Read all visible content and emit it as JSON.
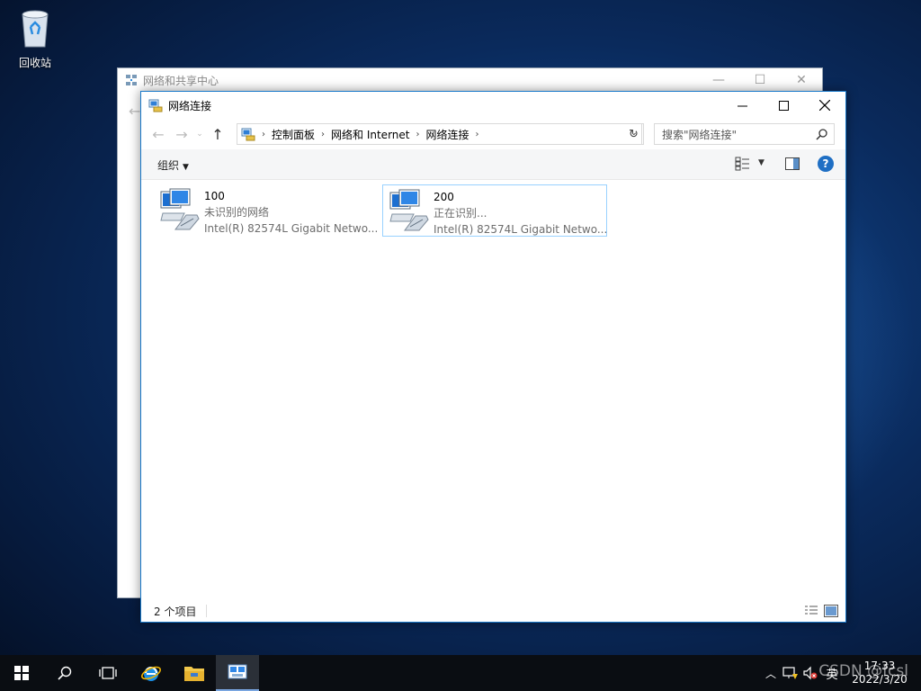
{
  "desktop": {
    "recycle_bin_label": "回收站"
  },
  "back_window": {
    "title": "网络和共享中心"
  },
  "window": {
    "title": "网络连接",
    "breadcrumb": [
      "控制面板",
      "网络和 Internet",
      "网络连接"
    ],
    "search_placeholder": "搜索\"网络连接\"",
    "organize_label": "组织",
    "help_label": "?",
    "items": [
      {
        "name": "100",
        "status": "未识别的网络",
        "device": "Intel(R) 82574L Gigabit Netwo..."
      },
      {
        "name": "200",
        "status": "正在识别...",
        "device": "Intel(R) 82574L Gigabit Netwo..."
      }
    ],
    "status_count": "2 个项目"
  },
  "taskbar": {
    "ime": "英",
    "time": "17:33",
    "date": "2022/3/20",
    "watermark": "CSDN @fcsl"
  },
  "colors": {
    "accent": "#1979ca",
    "selection_border": "#99d1ff",
    "taskbar": "#0a0d12"
  }
}
